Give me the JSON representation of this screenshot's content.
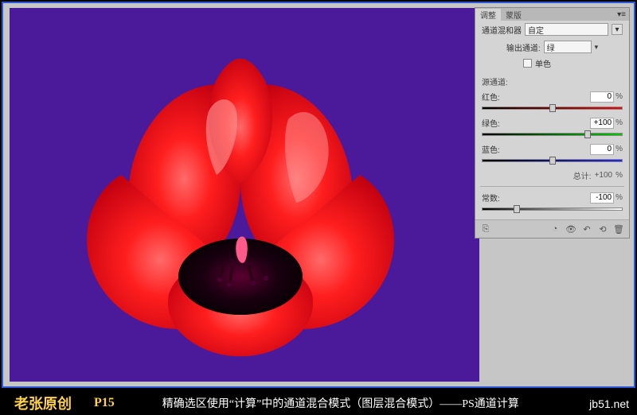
{
  "panel": {
    "tabs": {
      "adjust": "调整",
      "mask": "蒙版"
    },
    "title": "通道混和器",
    "preset_label": "自定",
    "output_label": "输出通道:",
    "output_value": "绿",
    "mono_label": "单色",
    "source_label": "源通道:",
    "sliders": {
      "red": {
        "label": "红色:",
        "value": "0",
        "pos": 50,
        "grad": "linear-gradient(to right,#000,#f00)"
      },
      "green": {
        "label": "绿色:",
        "value": "+100",
        "pos": 75,
        "grad": "linear-gradient(to right,#000,#0c0)"
      },
      "blue": {
        "label": "蓝色:",
        "value": "0",
        "pos": 50,
        "grad": "linear-gradient(to right,#000,#22f)"
      }
    },
    "total_label": "总计:",
    "total_value": "+100",
    "constant": {
      "label": "常数:",
      "value": "-100",
      "pos": 25,
      "grad": "linear-gradient(to right,#000,#fff)"
    }
  },
  "caption": {
    "author": "老张原创",
    "page": "P15",
    "title": "精确选区使用“计算”中的通道混合模式（图层混合模式）——PS通道计算"
  },
  "watermark": "jb51.net",
  "pct": "%"
}
